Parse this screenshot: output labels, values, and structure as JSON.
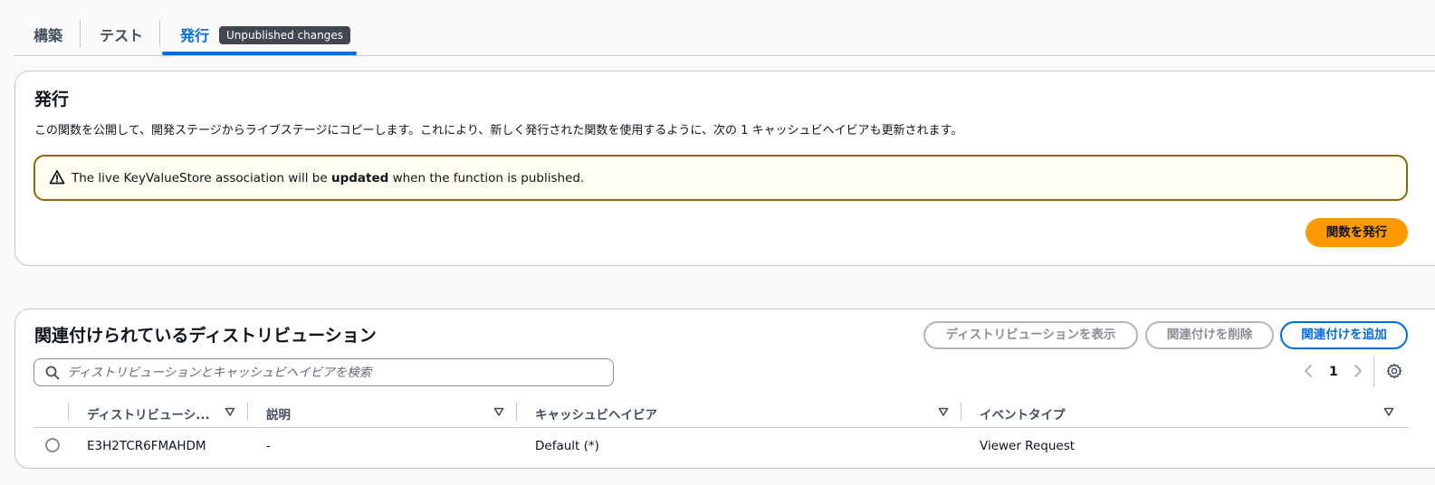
{
  "tabs": [
    {
      "label": "構築"
    },
    {
      "label": "テスト"
    },
    {
      "label": "発行",
      "badge": "Unpublished changes"
    }
  ],
  "publish": {
    "title": "発行",
    "description": "この関数を公開して、開発ステージからライブステージにコピーします。これにより、新しく発行された関数を使用するように、次の 1 キャッシュビヘイビアも更新されます。",
    "alert": {
      "prefix": "The live KeyValueStore association will be ",
      "bold": "updated",
      "suffix": " when the function is published."
    },
    "publish_button": "関数を発行"
  },
  "distributions": {
    "title": "関連付けられているディストリビューション",
    "buttons": {
      "view": "ディストリビューションを表示",
      "remove": "関連付けを削除",
      "add": "関連付けを追加"
    },
    "search_placeholder": "ディストリビューションとキャッシュビヘイビアを検索",
    "page": "1",
    "columns": [
      "ディストリビューシ...",
      "説明",
      "キャッシュビヘイビア",
      "イベントタイプ"
    ],
    "rows": [
      {
        "distribution": "E3H2TCR6FMAHDM",
        "description": "-",
        "cache_behavior": "Default (*)",
        "event_type": "Viewer Request"
      }
    ]
  },
  "colors": {
    "accent": "#006ce0",
    "primary_button": "#ff9900",
    "warning_border": "#8d6605",
    "warning_bg": "#fffef0",
    "badge_bg": "#424650"
  },
  "icons": [
    "warning-icon",
    "search-icon",
    "chevron-left-icon",
    "chevron-right-icon",
    "settings-icon",
    "sort-caret-icon"
  ]
}
